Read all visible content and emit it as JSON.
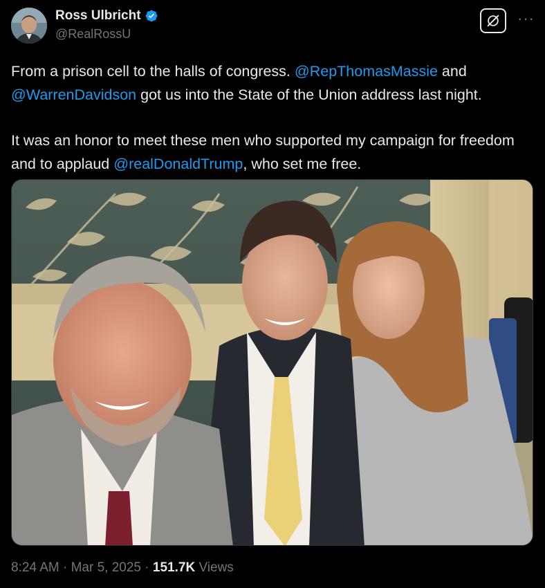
{
  "author": {
    "name": "Ross Ulbricht",
    "handle": "@RealRossU",
    "verified": true
  },
  "tweet": {
    "p1_text1": "From a prison cell to the halls of congress. ",
    "p1_mention1": "@RepThomasMassie",
    "p1_text2": " and ",
    "p1_mention2": "@WarrenDavidson",
    "p1_text3": " got us into the State of the Union address last night.",
    "p2_text1": "It was an honor to meet these men who supported my campaign for freedom and to applaud ",
    "p2_mention1": "@realDonaldTrump",
    "p2_text2": ", who set me free."
  },
  "meta": {
    "time": "8:24 AM",
    "sep1": " · ",
    "date": "Mar 5, 2025",
    "sep2": " · ",
    "views_count": "151.7K",
    "views_label": " Views"
  },
  "colors": {
    "background": "#000000",
    "text": "#e7e9ea",
    "secondary": "#71767b",
    "link": "#1d9bf0",
    "verified": "#1d9bf0"
  },
  "icons": {
    "verified": "verified-badge-icon",
    "grok": "grok-icon",
    "more": "more-icon"
  }
}
